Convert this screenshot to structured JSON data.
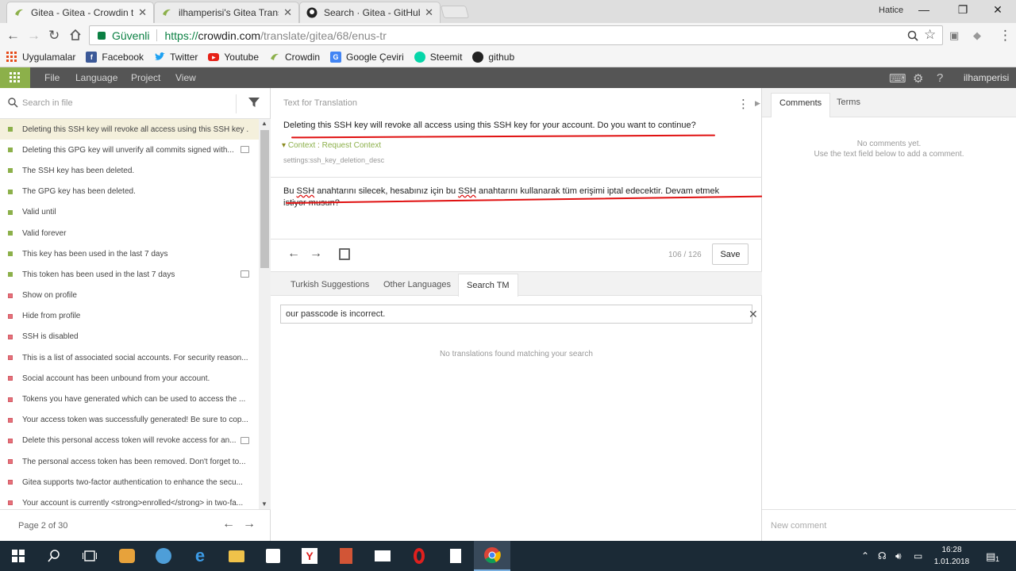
{
  "browser": {
    "tabs": [
      {
        "title": "Gitea - Gitea - Crowdin t",
        "active": true
      },
      {
        "title": "ilhamperisi's Gitea Transl",
        "active": false
      },
      {
        "title": "Search · Gitea - GitHub",
        "active": false
      }
    ],
    "profile_name": "Hatice",
    "secure_label": "Güvenli",
    "url_scheme": "https://",
    "url_host": "crowdin.com",
    "url_path": "/translate/gitea/68/enus-tr",
    "bookmarks": [
      {
        "label": "Uygulamalar",
        "icon": "apps-grid-icon",
        "color": "#e64a19"
      },
      {
        "label": "Facebook",
        "icon": "facebook-icon",
        "color": "#3b5998"
      },
      {
        "label": "Twitter",
        "icon": "twitter-icon",
        "color": "#1da1f2"
      },
      {
        "label": "Youtube",
        "icon": "youtube-icon",
        "color": "#e62117"
      },
      {
        "label": "Crowdin",
        "icon": "crowdin-icon",
        "color": "#8cb04a"
      },
      {
        "label": "Google Çeviri",
        "icon": "google-translate-icon",
        "color": "#4285f4"
      },
      {
        "label": "Steemit",
        "icon": "steemit-icon",
        "color": "#06d6a9"
      },
      {
        "label": "github",
        "icon": "github-icon",
        "color": "#222222"
      }
    ]
  },
  "toolbar": {
    "menu": [
      "File",
      "Language",
      "Project",
      "View"
    ],
    "user": "ilhamperisi"
  },
  "left": {
    "search_placeholder": "Search in file",
    "strings": [
      {
        "text": "Deleting this SSH key will revoke all access using this SSH key ...",
        "status": "done",
        "selected": true,
        "comment": false
      },
      {
        "text": "Deleting this GPG key will unverify all commits signed with...",
        "status": "done",
        "selected": false,
        "comment": true
      },
      {
        "text": "The SSH key has been deleted.",
        "status": "done",
        "selected": false,
        "comment": false
      },
      {
        "text": "The GPG key has been deleted.",
        "status": "done",
        "selected": false,
        "comment": false
      },
      {
        "text": "Valid until",
        "status": "done",
        "selected": false,
        "comment": false
      },
      {
        "text": "Valid forever",
        "status": "done",
        "selected": false,
        "comment": false
      },
      {
        "text": "This key has been used in the last 7 days",
        "status": "done",
        "selected": false,
        "comment": false
      },
      {
        "text": "This token has been used in the last 7 days",
        "status": "done",
        "selected": false,
        "comment": true
      },
      {
        "text": "Show on profile",
        "status": "todo",
        "selected": false,
        "comment": false
      },
      {
        "text": "Hide from profile",
        "status": "todo",
        "selected": false,
        "comment": false
      },
      {
        "text": "SSH is disabled",
        "status": "todo",
        "selected": false,
        "comment": false
      },
      {
        "text": "This is a list of associated social accounts. For security reason...",
        "status": "todo",
        "selected": false,
        "comment": false
      },
      {
        "text": "Social account has been unbound from your account.",
        "status": "todo",
        "selected": false,
        "comment": false
      },
      {
        "text": "Tokens you have generated which can be used to access the ...",
        "status": "todo",
        "selected": false,
        "comment": false
      },
      {
        "text": "Your access token was successfully generated! Be sure to cop...",
        "status": "todo",
        "selected": false,
        "comment": false
      },
      {
        "text": "Delete this personal access token will revoke access for an...",
        "status": "todo",
        "selected": false,
        "comment": true
      },
      {
        "text": "The personal access token has been removed. Don't forget to...",
        "status": "todo",
        "selected": false,
        "comment": false
      },
      {
        "text": "Gitea supports two-factor authentication to enhance the secu...",
        "status": "todo",
        "selected": false,
        "comment": false
      },
      {
        "text": "Your account is currently <strong>enrolled</strong> in two-fa...",
        "status": "todo",
        "selected": false,
        "comment": false
      }
    ],
    "page_label": "Page 2 of 30"
  },
  "middle": {
    "section_title": "Text for Translation",
    "source_text": "Deleting this SSH key will revoke all access using this SSH key for your account. Do you want to continue?",
    "context_label": "Context",
    "context_sep": " : ",
    "request_context_label": "Request Context",
    "string_key": "settings:ssh_key_deletion_desc",
    "translation_parts": {
      "p1": "Bu ",
      "ssh1": "SSH",
      "p2": " anahtarını silecek, hesabınız için bu ",
      "ssh2": "SSH",
      "p3": " anahtarını kullanarak tüm erişimi iptal edecektir. Devam etmek istiyor musun?"
    },
    "progress": "106 / 126",
    "save_label": "Save",
    "tabs": [
      "Turkish Suggestions",
      "Other Languages",
      "Search TM"
    ],
    "tm_search_value": "our passcode is incorrect.",
    "no_results": "No translations found matching your search"
  },
  "right": {
    "tabs": [
      "Comments",
      "Terms"
    ],
    "no_comments_line1": "No comments yet.",
    "no_comments_line2": "Use the text field below to add a comment.",
    "new_comment_placeholder": "New comment"
  },
  "taskbar": {
    "time": "16:28",
    "date": "1.01.2018",
    "notification_count": "1"
  },
  "colors": {
    "crowdin_green": "#8cb04a",
    "toolbar_bg": "#555555",
    "annotation_red": "#e01010",
    "taskbar_bg": "#1b2a36"
  }
}
